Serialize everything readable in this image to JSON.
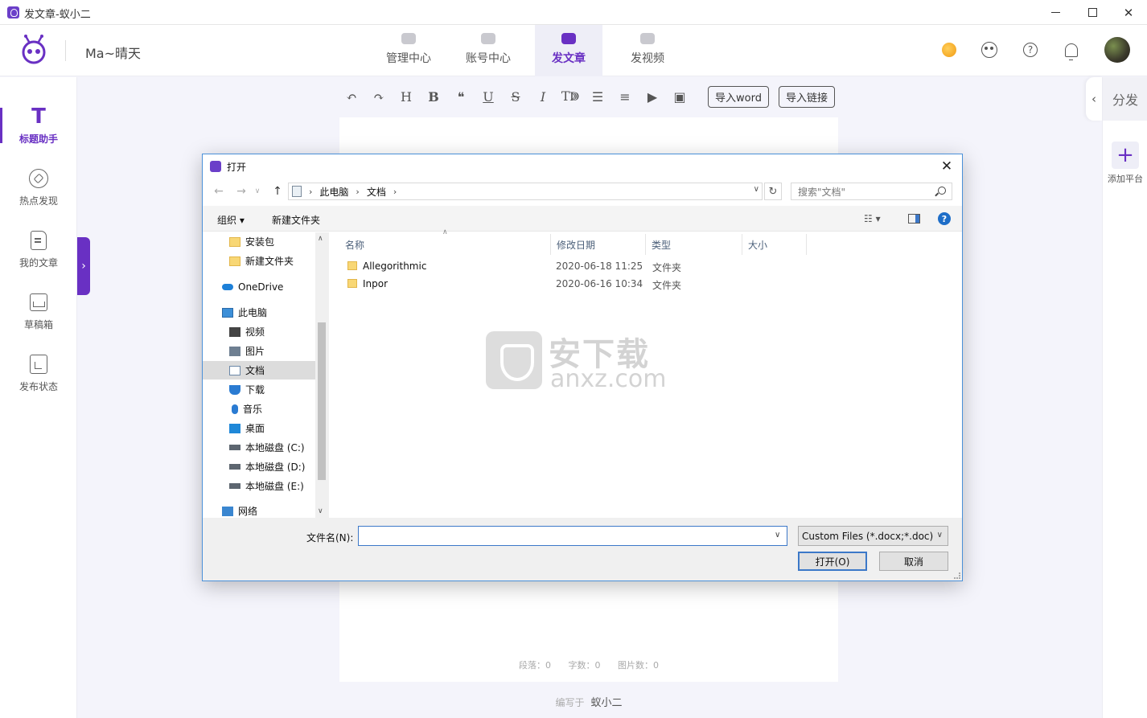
{
  "window": {
    "title": "发文章-蚁小二",
    "minimize": "minimize",
    "maximize": "maximize",
    "close": "✕"
  },
  "header": {
    "user_name": "Ma~晴天",
    "tabs": [
      {
        "label": "管理中心",
        "active": false
      },
      {
        "label": "账号中心",
        "active": false
      },
      {
        "label": "发文章",
        "active": true
      },
      {
        "label": "发视频",
        "active": false
      }
    ],
    "icons": [
      "coin-icon",
      "mascot-icon",
      "help-icon",
      "bell-icon",
      "avatar"
    ]
  },
  "sidebar": {
    "items": [
      {
        "label": "标题助手",
        "icon": "title-t-icon",
        "active": true
      },
      {
        "label": "热点发现",
        "icon": "compass-icon",
        "active": false
      },
      {
        "label": "我的文章",
        "icon": "document-icon",
        "active": false
      },
      {
        "label": "草稿箱",
        "icon": "inbox-icon",
        "active": false
      },
      {
        "label": "发布状态",
        "icon": "clipboard-icon",
        "active": false
      }
    ],
    "toggle": "›"
  },
  "toolbar": {
    "buttons": [
      {
        "icon": "undo-icon",
        "glyph": "↶"
      },
      {
        "icon": "redo-icon",
        "glyph": "↷"
      },
      {
        "icon": "heading-icon",
        "glyph": "H"
      },
      {
        "icon": "bold-icon",
        "glyph": "B"
      },
      {
        "icon": "quote-icon",
        "glyph": "❝"
      },
      {
        "icon": "underline-icon",
        "glyph": "U"
      },
      {
        "icon": "strikethrough-icon",
        "glyph": "S"
      },
      {
        "icon": "italic-icon",
        "glyph": "I"
      },
      {
        "icon": "font-size-icon",
        "glyph": "Tↇ"
      },
      {
        "icon": "list-icon",
        "glyph": "☰"
      },
      {
        "icon": "align-icon",
        "glyph": "≡"
      },
      {
        "icon": "video-icon",
        "glyph": "▶"
      },
      {
        "icon": "image-icon",
        "glyph": "▣"
      }
    ],
    "import_word": "导入word",
    "import_link": "导入链接"
  },
  "editor": {
    "stats": {
      "paragraphs": "段落：0",
      "words": "字数：0",
      "images": "图片数：0"
    },
    "author_prefix": "编写于",
    "author_name": "蚁小二"
  },
  "right_panel": {
    "title": "分发",
    "collapse": "‹",
    "add_label": "添加平台",
    "add_glyph": "+"
  },
  "dialog": {
    "title": "打开",
    "close": "✕",
    "address": {
      "crumbs": [
        "此电脑",
        "文档"
      ]
    },
    "search_placeholder": "搜索\"文档\"",
    "commands": {
      "organize": "组织 ▾",
      "new_folder": "新建文件夹",
      "view": "☷ ▾",
      "help": "?"
    },
    "tree": [
      {
        "label": "安装包",
        "icon": "folder"
      },
      {
        "label": "新建文件夹",
        "icon": "folder"
      },
      {
        "label": "OneDrive",
        "icon": "cloud"
      },
      {
        "label": "此电脑",
        "icon": "pc"
      },
      {
        "label": "视频",
        "icon": "video"
      },
      {
        "label": "图片",
        "icon": "pic"
      },
      {
        "label": "文档",
        "icon": "doc",
        "selected": true
      },
      {
        "label": "下载",
        "icon": "down"
      },
      {
        "label": "音乐",
        "icon": "music"
      },
      {
        "label": "桌面",
        "icon": "desk"
      },
      {
        "label": "本地磁盘 (C:)",
        "icon": "disk"
      },
      {
        "label": "本地磁盘 (D:)",
        "icon": "disk"
      },
      {
        "label": "本地磁盘 (E:)",
        "icon": "disk"
      },
      {
        "label": "网络",
        "icon": "net"
      }
    ],
    "columns": {
      "name": "名称",
      "date": "修改日期",
      "type": "类型",
      "size": "大小"
    },
    "files": [
      {
        "name": "Allegorithmic",
        "date": "2020-06-18 11:25",
        "type": "文件夹"
      },
      {
        "name": "Inpor",
        "date": "2020-06-16 10:34",
        "type": "文件夹"
      }
    ],
    "watermark": {
      "cn": "安下载",
      "en": "anxz.com"
    },
    "filename_label": "文件名(N):",
    "filename_value": "",
    "filetype": "Custom Files (*.docx;*.doc)",
    "open_button": "打开(O)",
    "cancel_button": "取消"
  },
  "colors": {
    "accent": "#6930c3",
    "accent_light": "#eeeef7",
    "background": "#f4f4fb",
    "dialog_border": "#4a90d9"
  }
}
